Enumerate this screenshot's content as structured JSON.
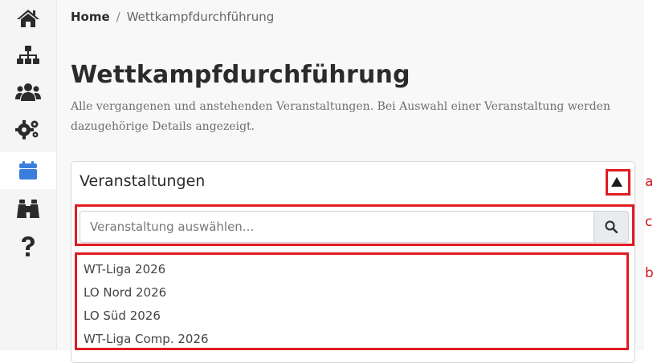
{
  "sidebar": {
    "items": [
      {
        "icon": "home-icon",
        "active": false
      },
      {
        "icon": "sitemap-icon",
        "active": false
      },
      {
        "icon": "users-icon",
        "active": false
      },
      {
        "icon": "gears-icon",
        "active": false
      },
      {
        "icon": "calendar-icon",
        "active": true
      },
      {
        "icon": "binoculars-icon",
        "active": false
      },
      {
        "icon": "question-icon",
        "active": false
      }
    ],
    "icon_color": "#2b2b2b",
    "active_color": "#3b7ddd"
  },
  "breadcrumb": {
    "home": "Home",
    "separator": "/",
    "current": "Wettkampfdurchführung"
  },
  "page": {
    "title": "Wettkampfdurchführung",
    "description": "Alle vergangenen und anstehenden Veranstaltungen. Bei Auswahl einer Veranstaltung werden dazugehörige Details angezeigt."
  },
  "card": {
    "title": "Veranstaltungen",
    "toggle_icon": "triangle-up-icon",
    "search": {
      "placeholder": "Veranstaltung auswählen...",
      "value": "",
      "button_icon": "search-icon"
    },
    "events": [
      "WT-Liga 2026",
      "LO Nord 2026",
      "LO Süd 2026",
      "WT-Liga Comp. 2026"
    ]
  },
  "annotations": {
    "labels": [
      "a",
      "b",
      "c"
    ],
    "color": "#e01b22"
  }
}
